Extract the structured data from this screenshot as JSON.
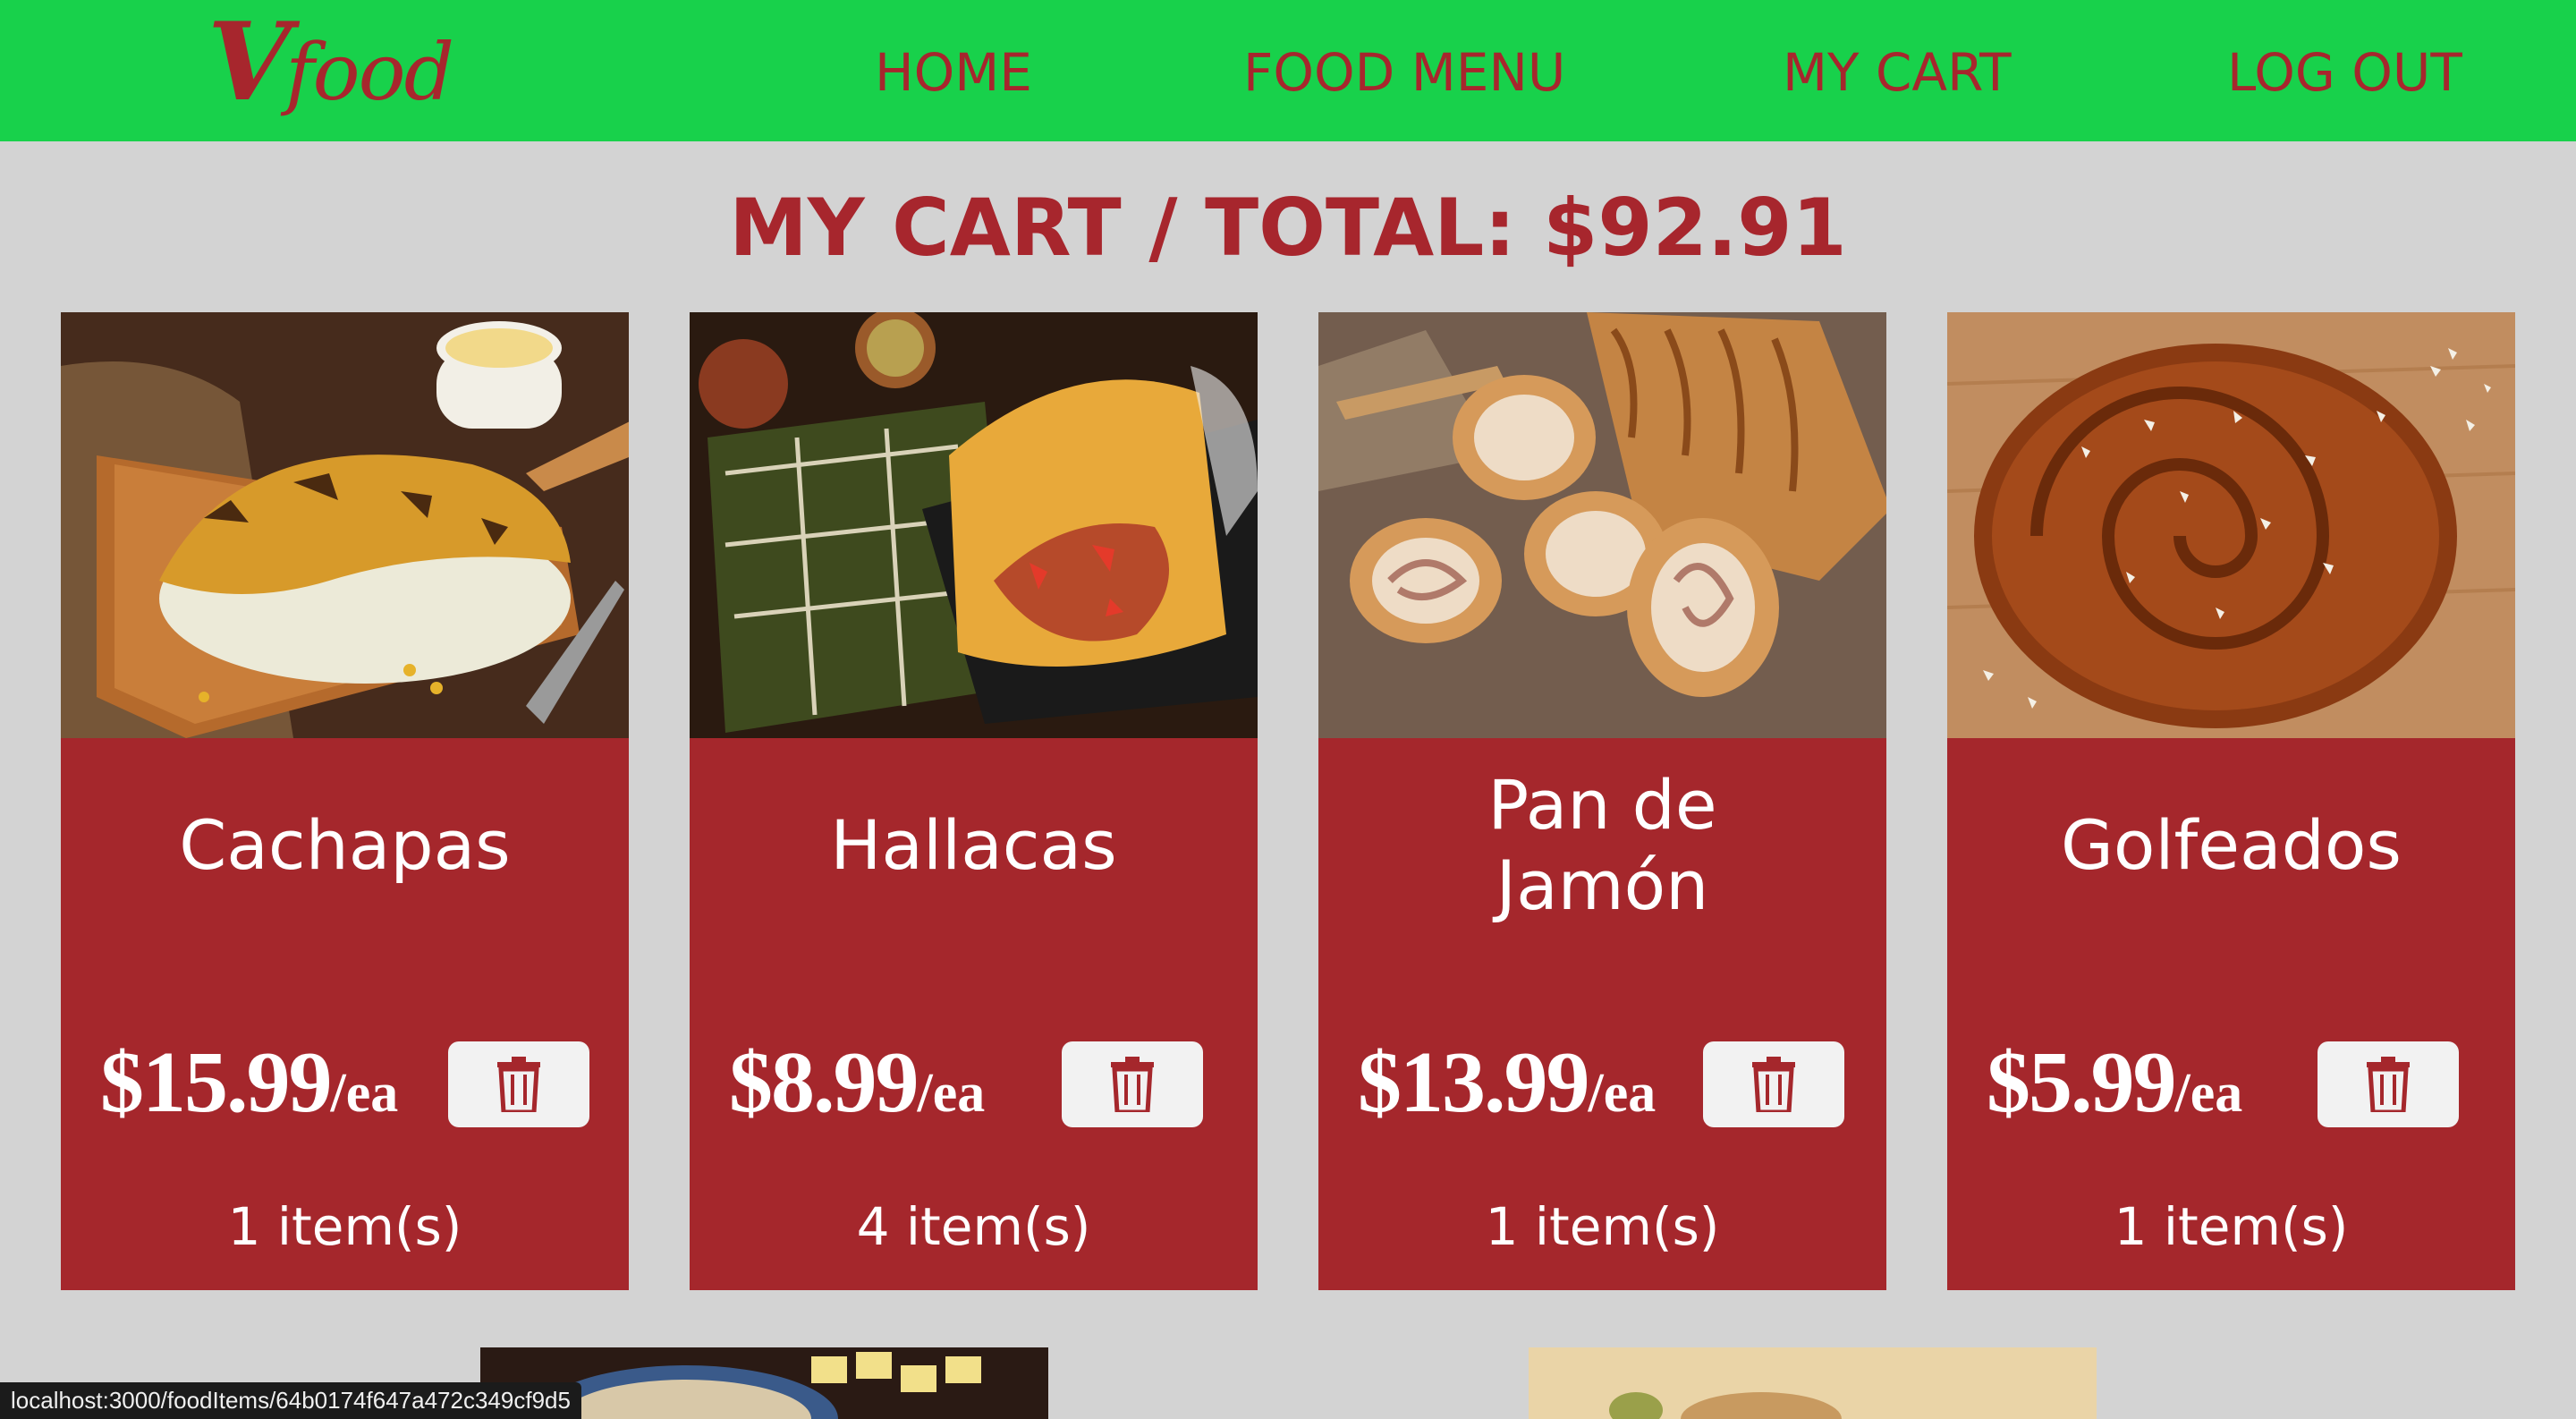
{
  "brand": {
    "logo_letter": "V",
    "logo_text": "food",
    "logo_color": "#a7262d",
    "nav_color": "#18d14b"
  },
  "nav": {
    "home": "HOME",
    "food_menu": "FOOD MENU",
    "my_cart": "MY CART",
    "log_out": "LOG OUT"
  },
  "page": {
    "title": "MY CART / TOTAL: $92.91",
    "background": "#d3d3d3",
    "card_color": "#a5272c"
  },
  "cart_items": [
    {
      "name": "Cachapas",
      "price": "$15.99",
      "unit": "/ea",
      "quantity": "1 item(s)",
      "delete_icon": "trash-icon"
    },
    {
      "name": "Hallacas",
      "price": "$8.99",
      "unit": "/ea",
      "quantity": "4 item(s)",
      "delete_icon": "trash-icon"
    },
    {
      "name": "Pan de Jamón",
      "price": "$13.99",
      "unit": "/ea",
      "quantity": "1 item(s)",
      "delete_icon": "trash-icon"
    },
    {
      "name": "Golfeados",
      "price": "$5.99",
      "unit": "/ea",
      "quantity": "1 item(s)",
      "delete_icon": "trash-icon"
    }
  ],
  "status_bar": {
    "url": "localhost:3000/foodItems/64b0174f647a472c349cf9d5"
  }
}
